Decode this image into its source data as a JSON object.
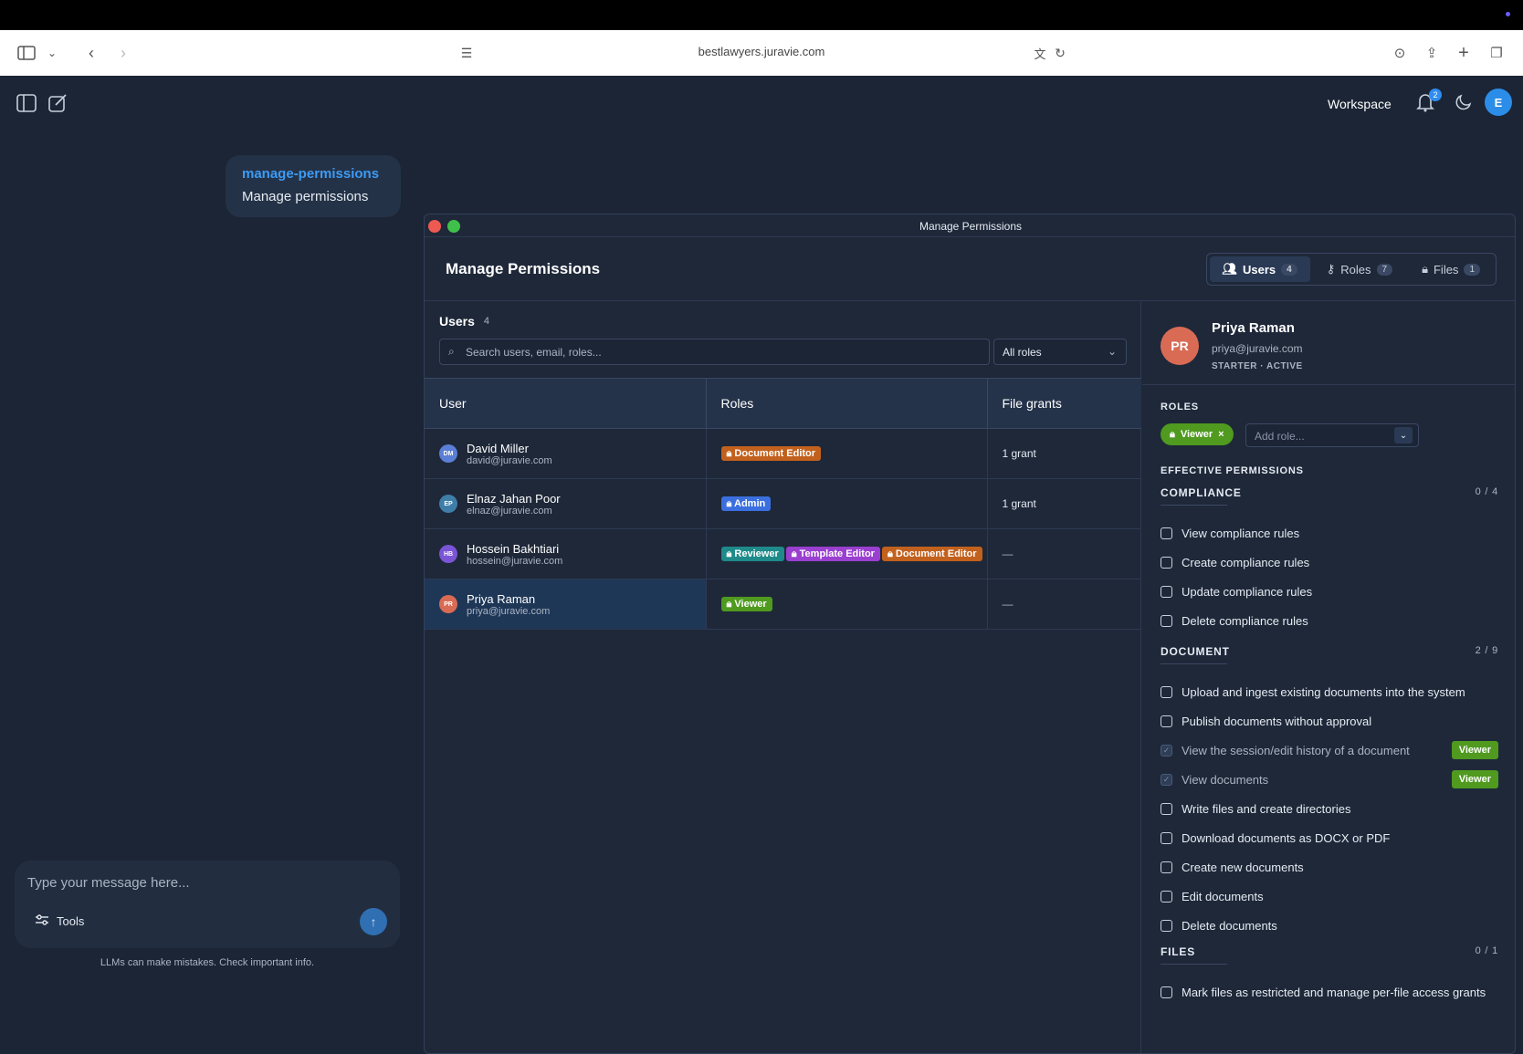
{
  "browser": {
    "url": "bestlawyers.juravie.com"
  },
  "app": {
    "workspace_label": "Workspace",
    "notification_count": "2",
    "user_initial": "E"
  },
  "chat": {
    "tool_name": "manage-permissions",
    "tool_desc": "Manage permissions",
    "composer_placeholder": "Type your message here...",
    "tools_label": "Tools",
    "disclaimer": "LLMs can make mistakes. Check important info."
  },
  "window": {
    "title": "Manage Permissions",
    "heading": "Manage Permissions",
    "tabs": [
      {
        "label": "Users",
        "count": "4",
        "active": true
      },
      {
        "label": "Roles",
        "count": "7",
        "active": false
      },
      {
        "label": "Files",
        "count": "1",
        "active": false
      }
    ]
  },
  "users_panel": {
    "heading": "Users",
    "count": "4",
    "search_placeholder": "Search users, email, roles...",
    "role_filter": "All roles",
    "columns": [
      "User",
      "Roles",
      "File grants"
    ],
    "rows": [
      {
        "initials": "DM",
        "avatar_color": "#5b7fd6",
        "name": "David Miller",
        "email": "david@juravie.com",
        "roles": [
          {
            "label": "Document Editor",
            "color": "#c2611d"
          }
        ],
        "grants": "1 grant",
        "selected": false
      },
      {
        "initials": "EP",
        "avatar_color": "#3e7ea8",
        "name": "Elnaz Jahan Poor",
        "email": "elnaz@juravie.com",
        "roles": [
          {
            "label": "Admin",
            "color": "#3b6fe0"
          }
        ],
        "grants": "1 grant",
        "selected": false
      },
      {
        "initials": "HB",
        "avatar_color": "#7a55d6",
        "name": "Hossein Bakhtiari",
        "email": "hossein@juravie.com",
        "roles": [
          {
            "label": "Reviewer",
            "color": "#1f8a8a"
          },
          {
            "label": "Template Editor",
            "color": "#9a3fd0"
          },
          {
            "label": "Document Editor",
            "color": "#c2611d"
          }
        ],
        "grants": "—",
        "selected": false
      },
      {
        "initials": "PR",
        "avatar_color": "#d96b55",
        "name": "Priya Raman",
        "email": "priya@juravie.com",
        "roles": [
          {
            "label": "Viewer",
            "color": "#4f9a1f"
          }
        ],
        "grants": "—",
        "selected": true
      }
    ]
  },
  "detail": {
    "initials": "PR",
    "name": "Priya Raman",
    "email": "priya@juravie.com",
    "status": "STARTER · ACTIVE",
    "roles_label": "ROLES",
    "role_chip": "Viewer",
    "add_role_placeholder": "Add role...",
    "effective_label": "EFFECTIVE PERMISSIONS",
    "categories": [
      {
        "name": "COMPLIANCE",
        "count": "0 / 4",
        "perms": [
          {
            "label": "View compliance rules",
            "checked": false,
            "tag": ""
          },
          {
            "label": "Create compliance rules",
            "checked": false,
            "tag": ""
          },
          {
            "label": "Update compliance rules",
            "checked": false,
            "tag": ""
          },
          {
            "label": "Delete compliance rules",
            "checked": false,
            "tag": ""
          }
        ]
      },
      {
        "name": "DOCUMENT",
        "count": "2 / 9",
        "perms": [
          {
            "label": "Upload and ingest existing documents into the system",
            "checked": false,
            "tag": ""
          },
          {
            "label": "Publish documents without approval",
            "checked": false,
            "tag": ""
          },
          {
            "label": "View the session/edit history of a document",
            "checked": true,
            "tag": "Viewer"
          },
          {
            "label": "View documents",
            "checked": true,
            "tag": "Viewer"
          },
          {
            "label": "Write files and create directories",
            "checked": false,
            "tag": ""
          },
          {
            "label": "Download documents as DOCX or PDF",
            "checked": false,
            "tag": ""
          },
          {
            "label": "Create new documents",
            "checked": false,
            "tag": ""
          },
          {
            "label": "Edit documents",
            "checked": false,
            "tag": ""
          },
          {
            "label": "Delete documents",
            "checked": false,
            "tag": ""
          }
        ]
      },
      {
        "name": "FILES",
        "count": "0 / 1",
        "perms": [
          {
            "label": "Mark files as restricted and manage per-file access grants",
            "checked": false,
            "tag": ""
          }
        ]
      }
    ]
  }
}
